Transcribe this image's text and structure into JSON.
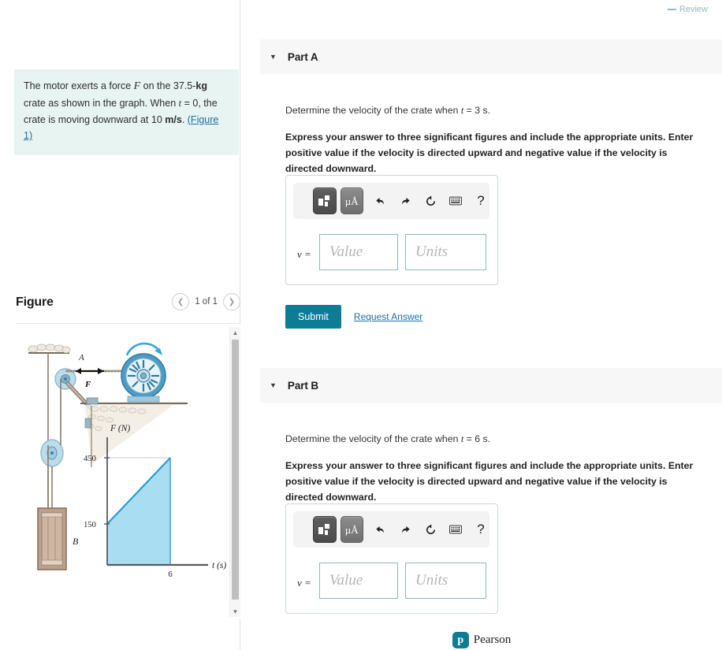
{
  "top_bar": {
    "review_label": "Review"
  },
  "problem": {
    "text_part1": "The motor exerts a force ",
    "force_symbol": "F",
    "text_part2": " on the 37.5-",
    "mass_unit": "kg",
    "text_part3": " crate as shown in the graph. When ",
    "time_symbol": "t",
    "text_part4": " = 0, the crate is moving downward at 10 ",
    "speed_unit": "m/s",
    "text_part5": ". ",
    "figure_link": "(Figure 1)"
  },
  "figure_panel": {
    "title": "Figure",
    "prev_icon": "chevron-left-icon",
    "next_icon": "chevron-right-icon",
    "counter": "1 of 1",
    "scroll_up_icon": "triangle-up-icon",
    "scroll_down_icon": "triangle-down-icon",
    "labels": {
      "point_a": "A",
      "force_f": "F",
      "crate_b": "B",
      "y_axis": "F (N)",
      "x_axis": "t (s)",
      "y_tick_high": "450",
      "y_tick_low": "150",
      "x_tick": "6"
    }
  },
  "chart_data": {
    "type": "line",
    "title": "",
    "xlabel": "t (s)",
    "ylabel": "F (N)",
    "x": [
      0,
      6
    ],
    "values": [
      150,
      450
    ],
    "xlim": [
      0,
      8
    ],
    "ylim": [
      0,
      500
    ],
    "xticks": [
      6
    ],
    "yticks": [
      150,
      450
    ],
    "fill": true,
    "fill_color": "#a9ddf2",
    "line_color": "#2b9cd1",
    "grid": false,
    "legend": null
  },
  "parts": [
    {
      "id": "part-a",
      "caret_icon": "caret-down-icon",
      "label": "Part A",
      "question_prefix": "Determine the velocity of the crate when ",
      "question_var": "t",
      "question_suffix": " = 3 s.",
      "instruction": "Express your answer to three significant figures and include the appropriate units. Enter positive value if the velocity is directed upward and negative value if the velocity is directed downward.",
      "answer": {
        "variable": "v =",
        "value_placeholder": "Value",
        "units_placeholder": "Units",
        "toolbar": {
          "template_icon": "math-template-icon",
          "units_icon": "micro-angstrom-icon",
          "units_label": "µÅ",
          "undo_icon": "undo-arrow-icon",
          "undo_glyph": "⮌",
          "redo_icon": "redo-arrow-icon",
          "redo_glyph": "⮎",
          "reset_icon": "reset-circle-icon",
          "reset_glyph": "↺",
          "keyboard_icon": "keyboard-icon",
          "help_icon": "help-question-icon",
          "help_glyph": "?"
        }
      },
      "submit_label": "Submit",
      "request_answer_label": "Request Answer",
      "has_submit": true
    },
    {
      "id": "part-b",
      "caret_icon": "caret-down-icon",
      "label": "Part B",
      "question_prefix": "Determine the velocity of the crate when ",
      "question_var": "t",
      "question_suffix": " = 6 s.",
      "instruction": "Express your answer to three significant figures and include the appropriate units. Enter positive value if the velocity is directed upward and negative value if the velocity is directed downward.",
      "answer": {
        "variable": "v =",
        "value_placeholder": "Value",
        "units_placeholder": "Units",
        "toolbar": {
          "template_icon": "math-template-icon",
          "units_icon": "micro-angstrom-icon",
          "units_label": "µÅ",
          "undo_icon": "undo-arrow-icon",
          "undo_glyph": "⮌",
          "redo_icon": "redo-arrow-icon",
          "redo_glyph": "⮎",
          "reset_icon": "reset-circle-icon",
          "reset_glyph": "↺",
          "keyboard_icon": "keyboard-icon",
          "help_icon": "help-question-icon",
          "help_glyph": "?"
        }
      },
      "has_submit": false
    }
  ],
  "footer": {
    "brand_mark": "pearson-logo-icon",
    "brand_glyph": "р",
    "brand_name": "Pearson"
  },
  "colors": {
    "accent_teal": "#0f7c95",
    "problem_bg": "#e8f4f2",
    "link_blue": "#1d6fa5",
    "chart_fill": "#a9ddf2",
    "chart_line": "#2b9cd1"
  }
}
